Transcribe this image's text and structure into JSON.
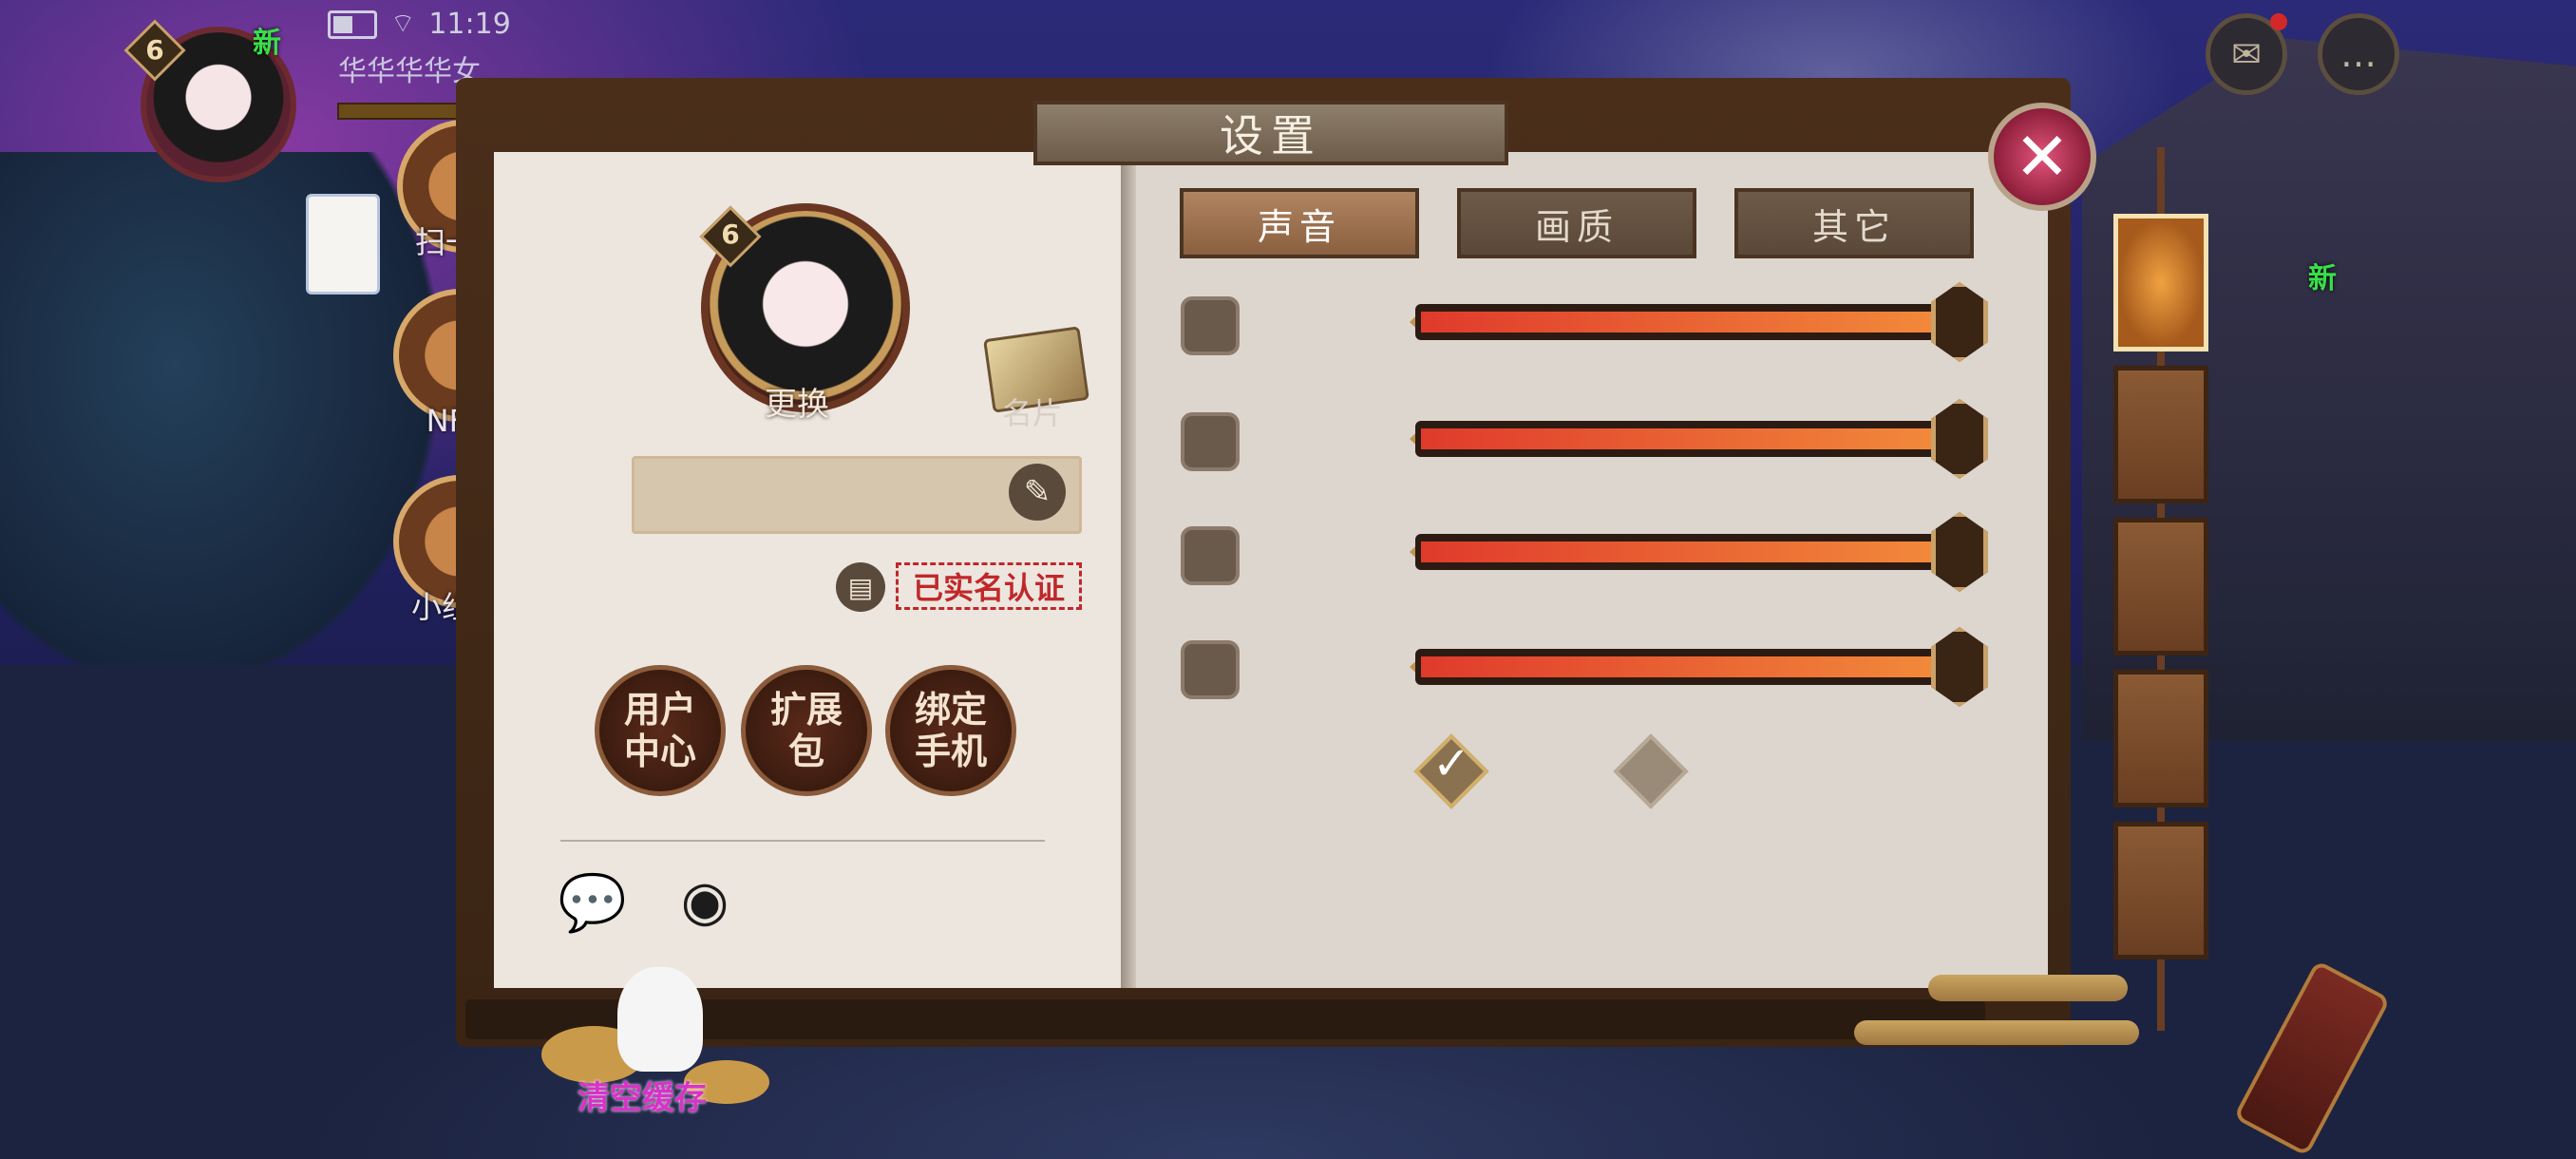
{
  "status_bar": {
    "time": "11:19",
    "wifi_icon": "wifi-icon",
    "battery_icon": "battery-icon"
  },
  "player": {
    "name": "华华华华女",
    "level": "6",
    "new_badge": "新"
  },
  "side_menu": [
    {
      "label": "扫一扫",
      "icon": "scan-icon"
    },
    {
      "label": "NFC",
      "icon": "nfc-icon"
    },
    {
      "label": "小组件",
      "icon": "widget-icon",
      "badge": "新"
    }
  ],
  "top_right": {
    "mail_icon": "mail-icon",
    "chat_icon": "chat-icon",
    "new_badge": "新"
  },
  "settings": {
    "title": "设置",
    "close_icon": "close-icon",
    "profile": {
      "level": "6",
      "change_label": "更换",
      "business_card_label": "名片",
      "name_value": "",
      "edit_icon": "pencil-icon",
      "doc_icon": "document-icon",
      "verified_stamp": "已实名认证"
    },
    "action_buttons": [
      {
        "label": "用户\n中心"
      },
      {
        "label": "扩展\n包"
      },
      {
        "label": "绑定\n手机"
      }
    ],
    "share": {
      "wechat_icon": "wechat-icon",
      "weibo_icon": "weibo-icon"
    },
    "tabs": [
      {
        "label": "声音",
        "active": true
      },
      {
        "label": "画质",
        "active": false
      },
      {
        "label": "其它",
        "active": false
      }
    ],
    "volume_sliders": [
      {
        "value_pct": 100
      },
      {
        "value_pct": 100
      },
      {
        "value_pct": 100
      },
      {
        "value_pct": 100
      }
    ],
    "toggles": [
      {
        "checked": true
      },
      {
        "checked": false
      }
    ]
  },
  "pet": {
    "name": "清空缓存"
  },
  "colors": {
    "accent": "#8a6040",
    "slider_fill": "#e8542e",
    "stamp_red": "#c0282a",
    "new_green": "#38e048"
  }
}
